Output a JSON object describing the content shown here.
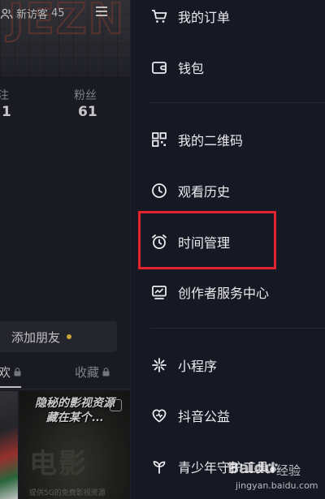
{
  "profile": {
    "visitor_label": "新访客",
    "visitor_count": "45",
    "stats": [
      {
        "label": "注",
        "value": "1"
      },
      {
        "label": "粉丝",
        "value": "61"
      }
    ],
    "add_friend_label": "添加朋友",
    "tabs": [
      "欢",
      "收藏"
    ],
    "video": {
      "title": "隐秘的影视资源\n藏在某个...",
      "big_text": "电影",
      "caption": "提供5G的免费影视资源"
    }
  },
  "drawer": {
    "items": [
      {
        "label": "我的订单",
        "icon": "cart-icon"
      },
      {
        "label": "钱包",
        "icon": "wallet-icon"
      },
      {
        "label": "我的二维码",
        "icon": "qr-code-icon"
      },
      {
        "label": "观看历史",
        "icon": "clock-icon"
      },
      {
        "label": "时间管理",
        "icon": "alarm-clock-icon"
      },
      {
        "label": "创作者服务中心",
        "icon": "creator-center-icon"
      },
      {
        "label": "小程序",
        "icon": "mini-program-icon"
      },
      {
        "label": "抖音公益",
        "icon": "charity-heart-icon"
      },
      {
        "label": "青少年守护工具",
        "icon": "sprout-icon"
      }
    ],
    "highlighted": "时间管理"
  },
  "watermark": {
    "brand": "Baidu",
    "suffix": "经验",
    "url": "jingyan.baidu.com"
  },
  "colors": {
    "background": "#161823",
    "highlight_border": "#e4232c",
    "notify_dot": "#f2c53d"
  }
}
